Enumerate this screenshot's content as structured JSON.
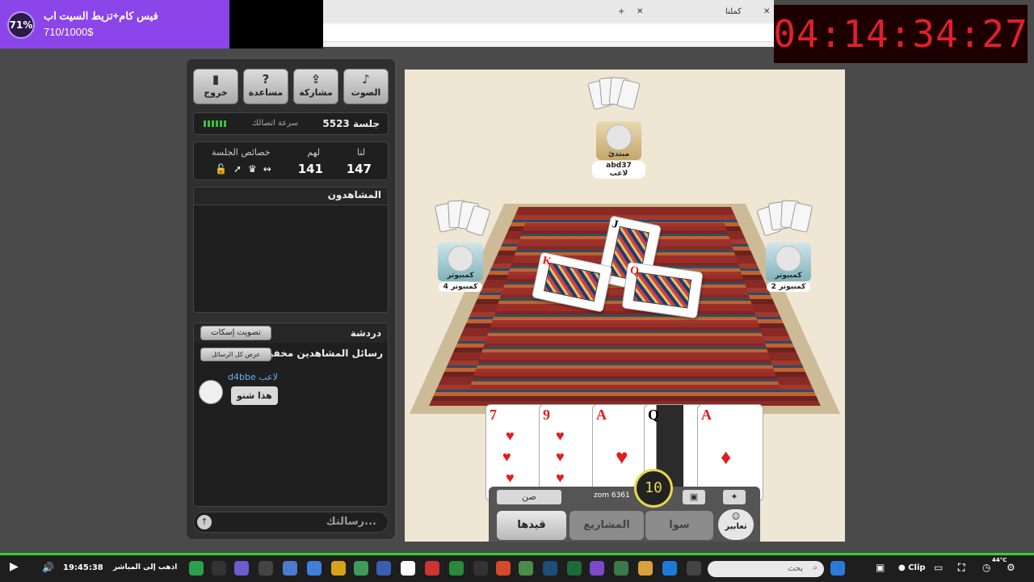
{
  "browser": {
    "tab_title": "كملنا"
  },
  "donation": {
    "percent": "71%",
    "title": "فيس كام+تزيط السيت اب",
    "amount": "710/1000$"
  },
  "stream_timer": "04:14:34:27",
  "panel": {
    "buttons": [
      {
        "label": "خروج",
        "icon": "exit-icon"
      },
      {
        "label": "مساعدة",
        "icon": "help-icon"
      },
      {
        "label": "مشاركة",
        "icon": "share-icon"
      },
      {
        "label": "الصوت",
        "icon": "sound-icon"
      }
    ],
    "session_label": "جلسة 5523",
    "speed_label": "سرعة اتصالك",
    "score": {
      "us_label": "لنا",
      "them_label": "لهم",
      "props_label": "خصائص الجلسة",
      "us": "147",
      "them": "141"
    },
    "watchers_title": "المشاهدون",
    "chat": {
      "title": "دردشة",
      "mute_button": "تصويت إسكات",
      "hidden_text": "رسائل المشاهدين مخفية",
      "show_all_button": "عرض كل الرسائل",
      "sender": "d4bbe لاعب",
      "message": "هذا شنو"
    },
    "input_placeholder": "رسالتك..."
  },
  "game": {
    "players": {
      "top": {
        "role": "مبتدئ",
        "name": "abd37 لاعب"
      },
      "left": {
        "role": "كمبيوتر",
        "name": "كمبيوتر 4"
      },
      "right": {
        "role": "كمبيوتر",
        "name": "كمبيوتر 2"
      }
    },
    "table_cards": [
      "J",
      "K",
      "Q"
    ],
    "hand": [
      "7",
      "9",
      "A",
      "Q",
      "A"
    ],
    "sun_label": "صن",
    "player_tag": "zom 6361",
    "turn_timer": "10",
    "buttons": {
      "qaydha": "قيدها",
      "mashari": "المشاريع",
      "sawa": "سوا",
      "tabeer": "تعابير"
    }
  },
  "taskbar": {
    "clock": "19:45:38",
    "go_live": "اذهب إلى المباشر",
    "search": "بحث",
    "clip": "Clip",
    "temp": "44°C"
  }
}
